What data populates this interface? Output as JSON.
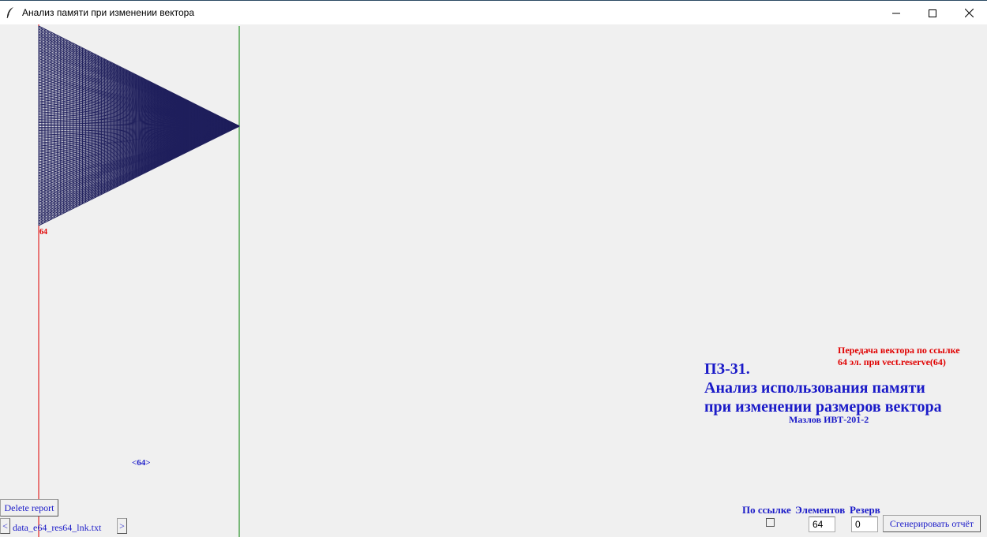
{
  "window": {
    "title": "Анализ памяти при изменении вектора",
    "minimize_icon": "minimize-icon",
    "maximize_icon": "maximize-icon",
    "close_icon": "close-icon"
  },
  "canvas": {
    "element_count_label": "64",
    "bottom_label": "<64>",
    "colors": {
      "triangle": "#1f1f5c",
      "red_line": "#e00000",
      "green_line": "#008000"
    }
  },
  "info": {
    "ref_note_line1": "Передача вектора по ссылке",
    "ref_note_line2": "64 эл. при vect.reserve(64)",
    "title_line1": "ПЗ-31.",
    "title_line2": "Анализ использования памяти",
    "title_line3": "при изменении размеров вектора",
    "author": "Мазлов ИВТ-201-2"
  },
  "controls": {
    "by_ref_label": "По ссылке",
    "elements_label": "Элементов",
    "reserve_label": "Резерв",
    "by_ref_checked": false,
    "elements_value": "64",
    "reserve_value": "0",
    "generate_label": "Сгенерировать отчёт",
    "delete_label": "Delete report",
    "prev_label": "<",
    "next_label": ">",
    "file_name": "data_e64_res64_lnk.txt"
  }
}
